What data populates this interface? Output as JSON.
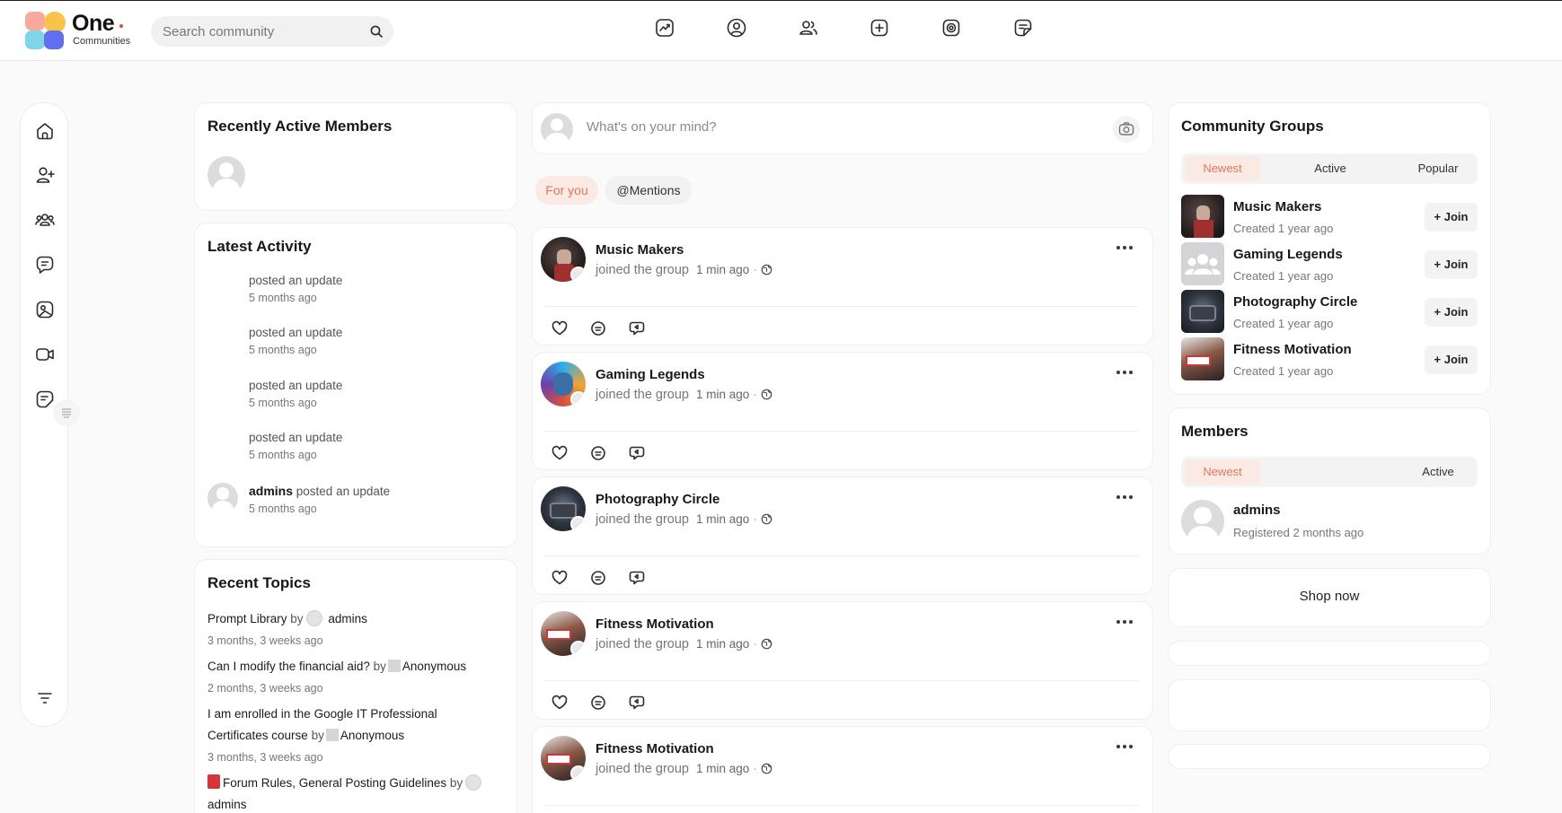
{
  "brand": {
    "name": "One",
    "subtitle": "Communities"
  },
  "search": {
    "placeholder": "Search community"
  },
  "recent_members": {
    "title": "Recently Active Members"
  },
  "latest_activity": {
    "title": "Latest Activity",
    "items": [
      {
        "user": "",
        "text": "posted an update",
        "time": "5 months ago"
      },
      {
        "user": "",
        "text": "posted an update",
        "time": "5 months ago"
      },
      {
        "user": "",
        "text": "posted an update",
        "time": "5 months ago"
      },
      {
        "user": "",
        "text": "posted an update",
        "time": "5 months ago"
      },
      {
        "user": "admins",
        "text": "posted an update",
        "time": "5 months ago"
      }
    ]
  },
  "recent_topics": {
    "title": "Recent Topics",
    "by": "by",
    "items": [
      {
        "title": "Prompt Library",
        "author": "admins",
        "time": "3 months, 3 weeks ago"
      },
      {
        "title": "Can I modify the financial aid?",
        "author": "Anonymous",
        "time": "2 months, 3 weeks ago"
      },
      {
        "title_line1": "I am enrolled in the Google IT Professional",
        "title_line2": "Certificates course",
        "author": "Anonymous",
        "time": "3 months, 3 weeks ago"
      },
      {
        "title": "Forum Rules, General Posting Guidelines",
        "author": "admins"
      }
    ]
  },
  "composer": {
    "placeholder": "What's on your mind?"
  },
  "feed_tabs": {
    "for_you": "For you",
    "mentions": "@Mentions"
  },
  "feed": [
    {
      "group": "Music Makers",
      "action": "joined the group",
      "time": "1 min ago"
    },
    {
      "group": "Gaming Legends",
      "action": "joined the group",
      "time": "1 min ago"
    },
    {
      "group": "Photography Circle",
      "action": "joined the group",
      "time": "1 min ago"
    },
    {
      "group": "Fitness Motivation",
      "action": "joined the group",
      "time": "1 min ago"
    },
    {
      "group": "Fitness Motivation",
      "action": "joined the group",
      "time": "1 min ago"
    }
  ],
  "community_groups": {
    "title": "Community Groups",
    "tabs": [
      "Newest",
      "Active",
      "Popular"
    ],
    "join_label": "+ Join",
    "items": [
      {
        "name": "Music Makers",
        "created": "Created 1 year ago"
      },
      {
        "name": "Gaming Legends",
        "created": "Created 1 year ago"
      },
      {
        "name": "Photography Circle",
        "created": "Created 1 year ago"
      },
      {
        "name": "Fitness Motivation",
        "created": "Created 1 year ago"
      }
    ]
  },
  "members": {
    "title": "Members",
    "tabs": [
      "Newest",
      "Active"
    ],
    "items": [
      {
        "name": "admins",
        "registered": "Registered 2 months ago"
      }
    ]
  },
  "shop": {
    "label": "Shop now"
  },
  "colors": {
    "accent": "#e0785d",
    "accent_bg": "#fbe9e4"
  },
  "icons": {
    "top_nav": [
      "activity-chart-icon",
      "profile-icon",
      "members-icon",
      "add-post-icon",
      "camera-target-icon",
      "notes-icon"
    ],
    "rail": [
      "home-icon",
      "add-friend-icon",
      "groups-icon",
      "messages-icon",
      "photos-icon",
      "video-icon",
      "forum-icon",
      "filter-icon"
    ]
  }
}
